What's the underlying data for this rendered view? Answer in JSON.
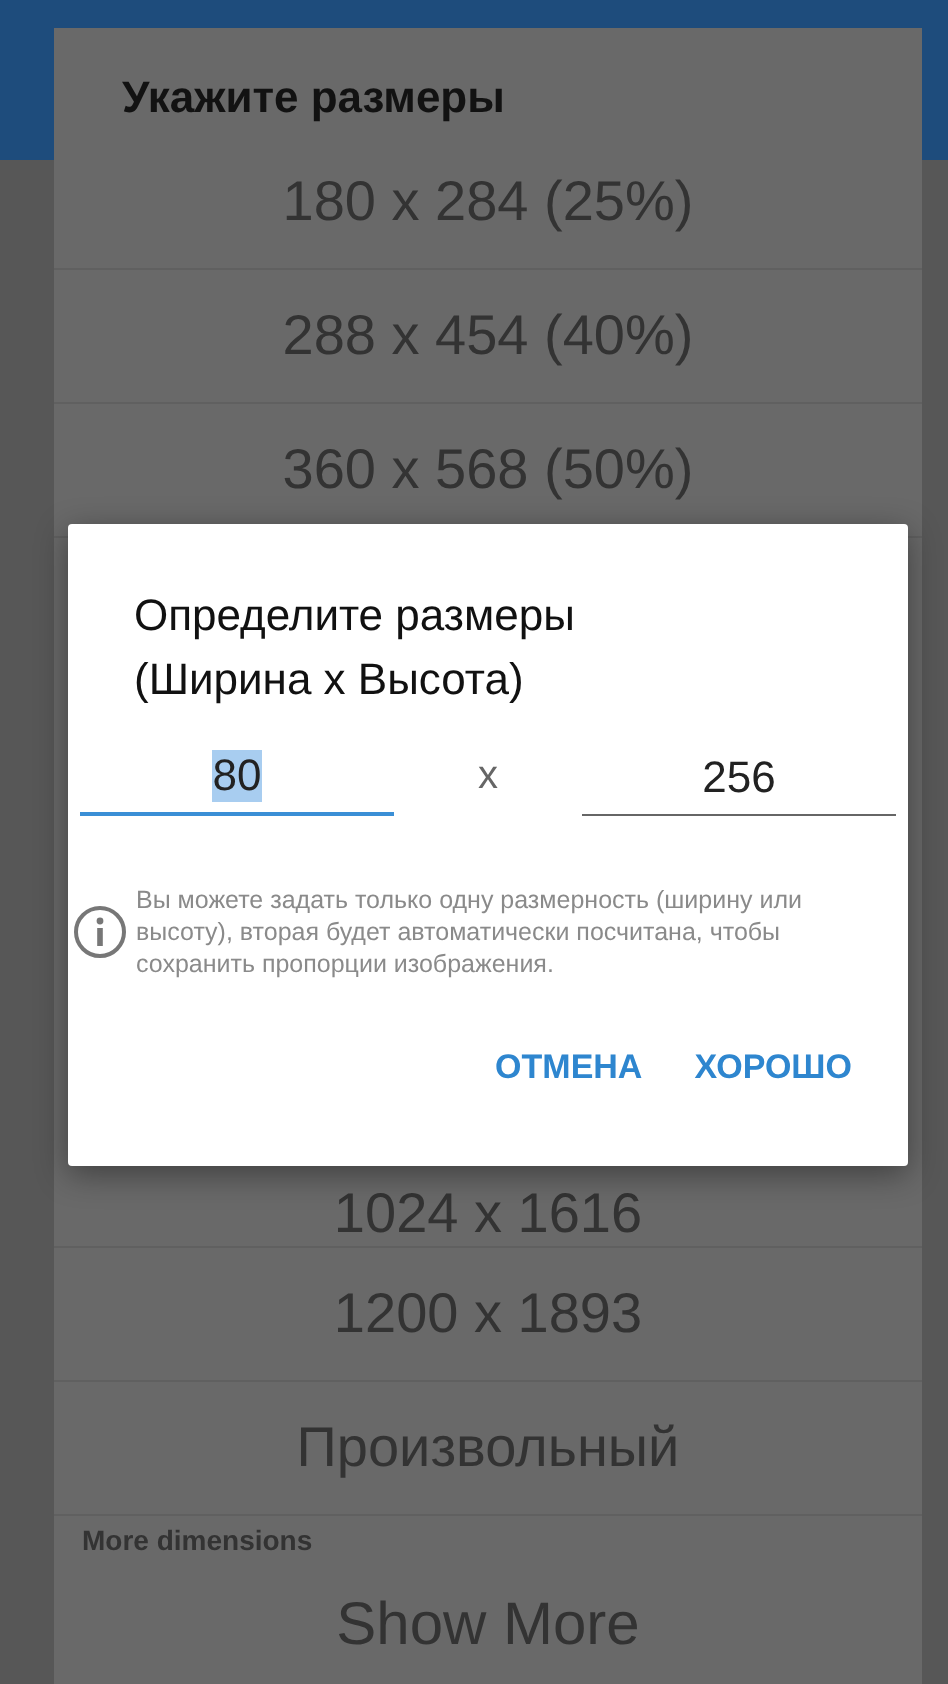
{
  "background_dialog": {
    "title": "Укажите размеры",
    "options": [
      {
        "label": "180 x 284  (25%)"
      },
      {
        "label": "288 x 454  (40%)"
      },
      {
        "label": "360 x 568  (50%)"
      },
      {
        "label": "1024 x 1616"
      },
      {
        "label": "1200 x 1893"
      },
      {
        "label": "Произвольный"
      }
    ],
    "section_label": "More dimensions",
    "show_more": "Show More"
  },
  "dialog": {
    "title": "Определите размеры\n(Ширина x Высота)",
    "width_field": {
      "value": "80",
      "focused": true
    },
    "separator": "x",
    "height_field": {
      "value": "256",
      "focused": false
    },
    "info": "Вы можете задать только одну размерность (ширину или высоту), вторая будет автоматически посчитана, чтобы сохранить пропорции изображения.",
    "buttons": [
      "ОТМЕНА",
      "ХОРОШО"
    ]
  }
}
